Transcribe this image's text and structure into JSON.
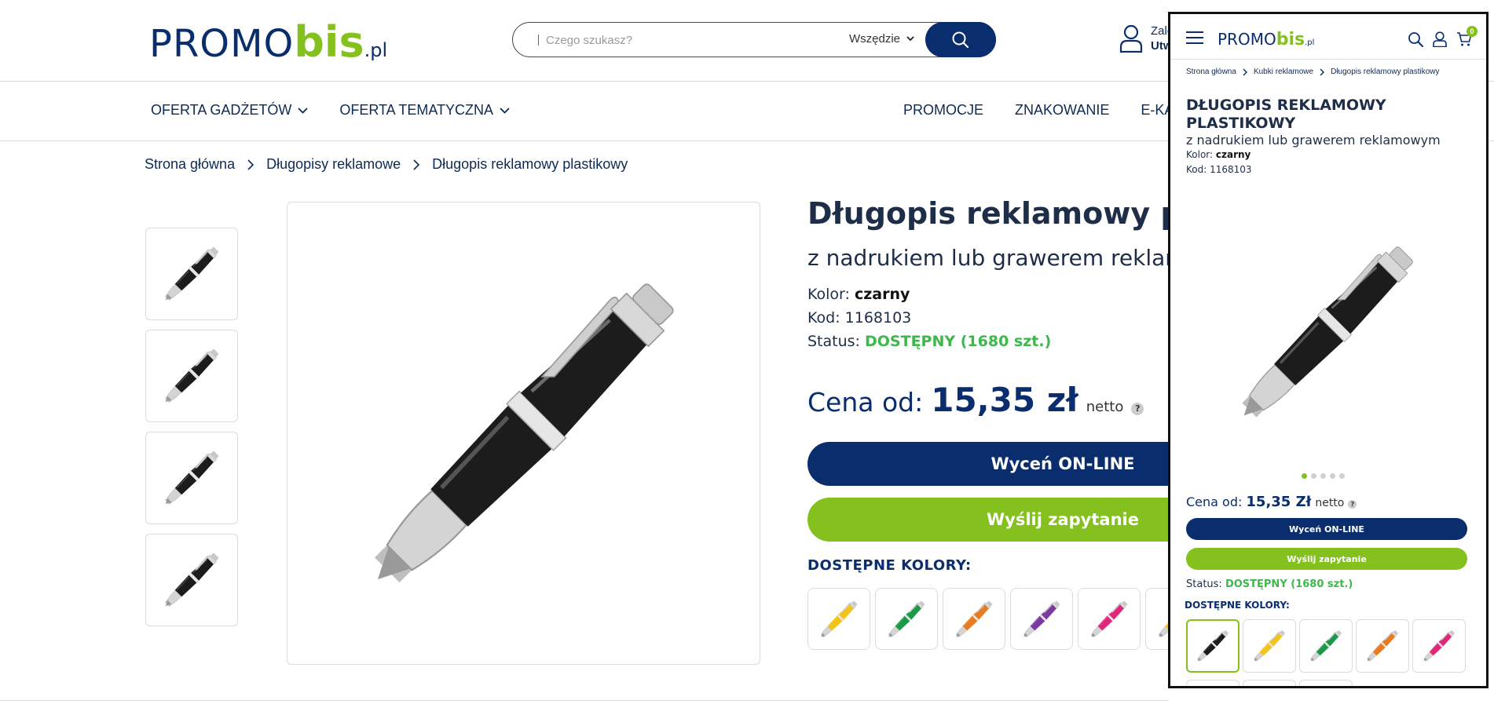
{
  "header": {
    "logo": {
      "promo": "PROMO",
      "bis": "bis",
      "pl": ".pl"
    },
    "search": {
      "placeholder": "Czego szukasz?",
      "scope": "Wszędzie"
    },
    "account": {
      "line1": "Zalo",
      "line2": "Utw"
    }
  },
  "nav": {
    "left": [
      "OFERTA GADŻETÓW",
      "OFERTA TEMATYCZNA"
    ],
    "right": [
      "PROMOCJE",
      "ZNAKOWANIE",
      "E-KATA"
    ]
  },
  "breadcrumb": [
    "Strona główna",
    "Długopisy reklamowe",
    "Długopis reklamowy plastikowy"
  ],
  "product": {
    "title": "Długopis reklamowy plast",
    "subtitle": "z nadrukiem lub grawerem reklamo",
    "color_label": "Kolor:",
    "color_value": "czarny",
    "code_label": "Kod:",
    "code_value": "1168103",
    "status_label": "Status:",
    "status_value": "DOSTĘPNY (1680 szt.)",
    "price_label": "Cena od:",
    "price_value": "15,35 zł",
    "price_net": "netto",
    "help": "?",
    "btn_quote": "Wyceń ON-LINE",
    "btn_inquiry": "Wyślij zapytanie",
    "colors_heading": "DOSTĘPNE KOLORY:",
    "pen_body_color": "#1c1c1c",
    "swatch_colors": [
      "#f2c415",
      "#1a9a48",
      "#e87b1e",
      "#7b3aa0",
      "#e0257a",
      "#f2c415"
    ]
  },
  "mobile": {
    "logo": {
      "promo": "PROMO",
      "bis": "bis",
      "pl": ".pl"
    },
    "cart_count": "0",
    "breadcrumb": [
      "Strona główna",
      "Kubki reklamowe",
      "Długopis reklamowy plastikowy"
    ],
    "title": "DŁUGOPIS REKLAMOWY PLASTIKOWY",
    "subtitle": "z nadrukiem lub grawerem reklamowym",
    "color_label": "Kolor:",
    "color_value": "czarny",
    "code_label": "Kod:",
    "code_value": "1168103",
    "price_label": "Cena od:",
    "price_value": "15,35 Zł",
    "price_net": "netto",
    "help": "?",
    "btn_quote": "Wyceń ON-LINE",
    "btn_inquiry": "Wyślij zapytanie",
    "status_label": "Status:",
    "status_value": "DOSTĘPNY (1680 szt.)",
    "colors_heading": "DOSTĘPNE KOLORY:",
    "swatch_colors": [
      "#1c1c1c",
      "#f2c415",
      "#1a9a48",
      "#e87b1e",
      "#e0257a"
    ]
  },
  "colors": {
    "navy": "#0a2d6e",
    "green": "#84c01e",
    "status_green": "#3db84a"
  }
}
